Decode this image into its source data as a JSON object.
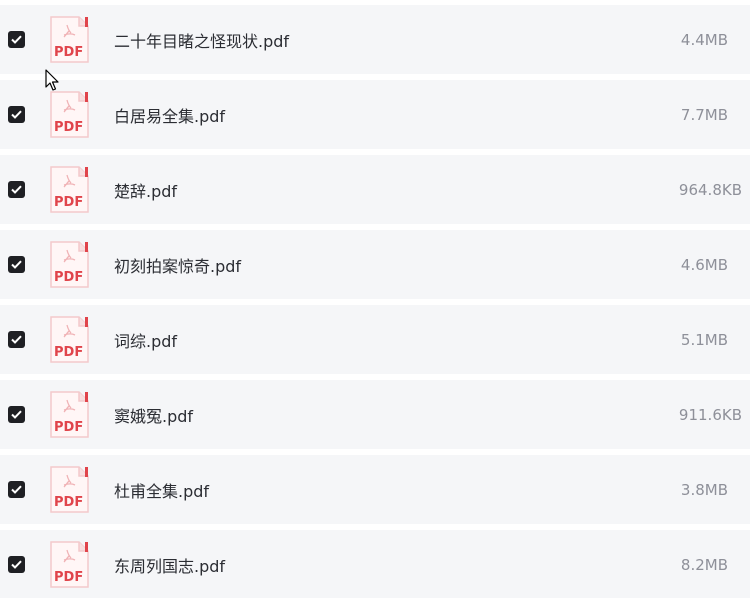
{
  "files": [
    {
      "name": "二十年目睹之怪现状.pdf",
      "size": "4.4MB",
      "checked": true
    },
    {
      "name": "白居易全集.pdf",
      "size": "7.7MB",
      "checked": true
    },
    {
      "name": "楚辞.pdf",
      "size": "964.8KB",
      "checked": true
    },
    {
      "name": "初刻拍案惊奇.pdf",
      "size": "4.6MB",
      "checked": true
    },
    {
      "name": "词综.pdf",
      "size": "5.1MB",
      "checked": true
    },
    {
      "name": "窦娥冤.pdf",
      "size": "911.6KB",
      "checked": true
    },
    {
      "name": "杜甫全集.pdf",
      "size": "3.8MB",
      "checked": true
    },
    {
      "name": "东周列国志.pdf",
      "size": "8.2MB",
      "checked": true
    }
  ],
  "icons": {
    "checkbox": "checkbox-checked-icon",
    "file": "pdf-file-icon",
    "file_label": "PDF",
    "cursor": "mouse-pointer-icon"
  },
  "colors": {
    "row_background": "#f5f6f8",
    "checkbox": "#1f2024",
    "pdf_red": "#e0444b",
    "size_text": "#8e9099"
  }
}
